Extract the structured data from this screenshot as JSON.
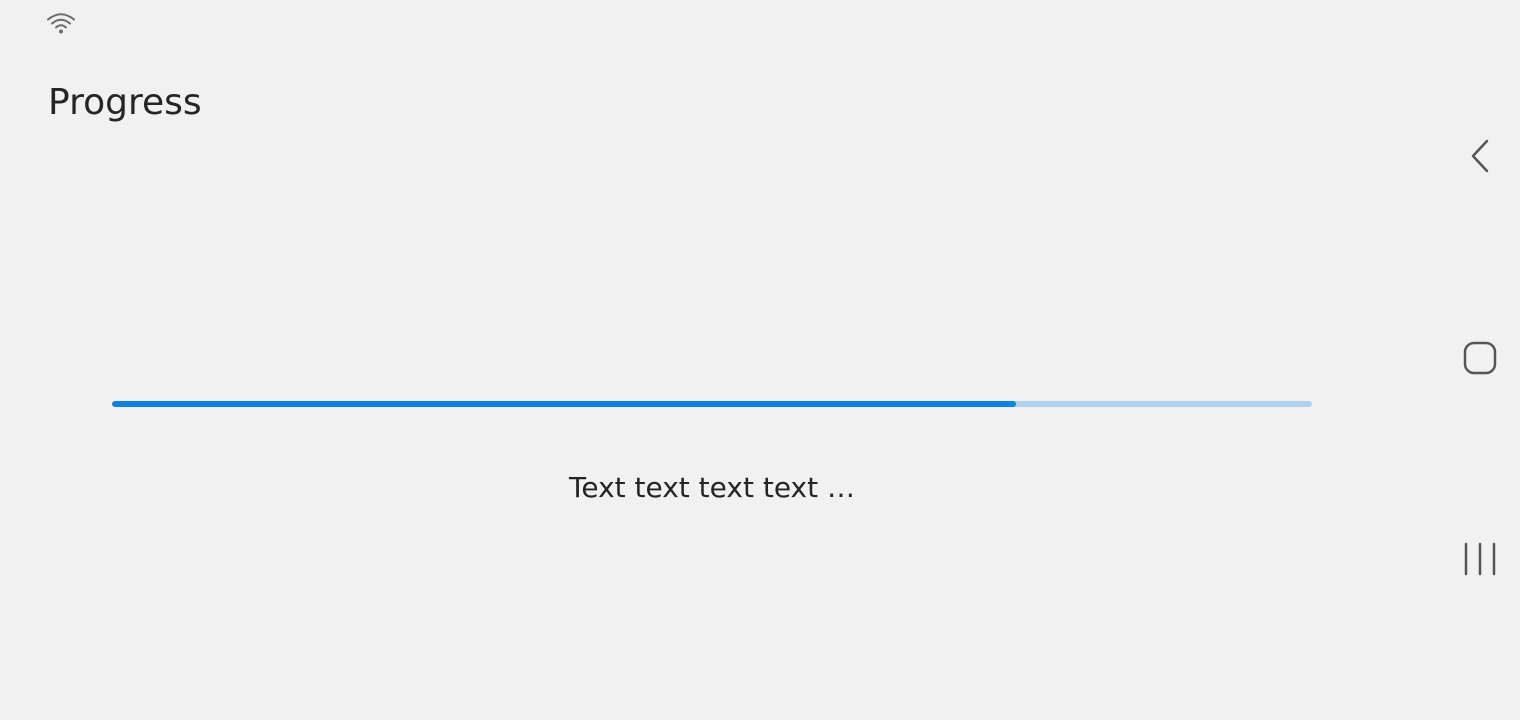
{
  "status_bar": {
    "icons": [
      "wifi-icon"
    ]
  },
  "page": {
    "title": "Progress"
  },
  "progress": {
    "value": 0.753,
    "caption": "Text text text text …",
    "fill_color": "#0b81ea",
    "track_color": "#aed1f1"
  },
  "nav_bar": {
    "icons": [
      "back-icon",
      "home-icon",
      "recents-icon"
    ]
  },
  "colors": {
    "background": "#f1f1f1",
    "text": "#252525",
    "icon": "#555555"
  }
}
